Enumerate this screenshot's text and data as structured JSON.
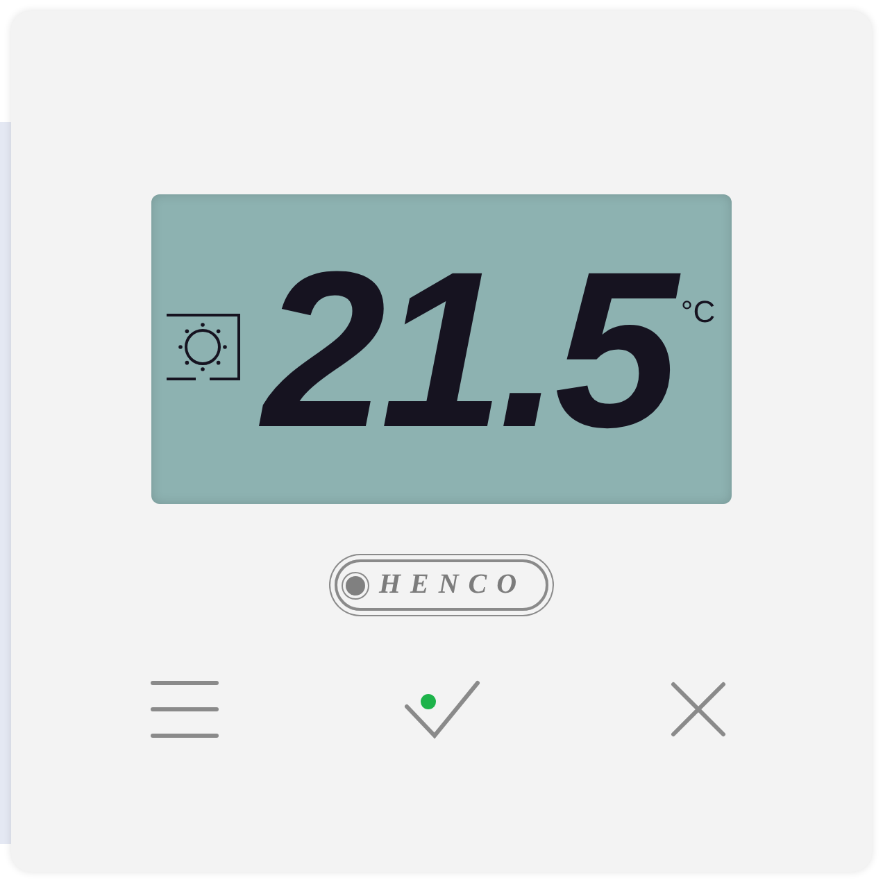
{
  "display": {
    "sun_mode": true,
    "temperature": "21.5",
    "unit": "°C"
  },
  "brand": "HENCO",
  "buttons": [
    {
      "kind": "menu",
      "led": false
    },
    {
      "kind": "confirm",
      "led": true
    },
    {
      "kind": "cancel",
      "led": false
    }
  ]
}
